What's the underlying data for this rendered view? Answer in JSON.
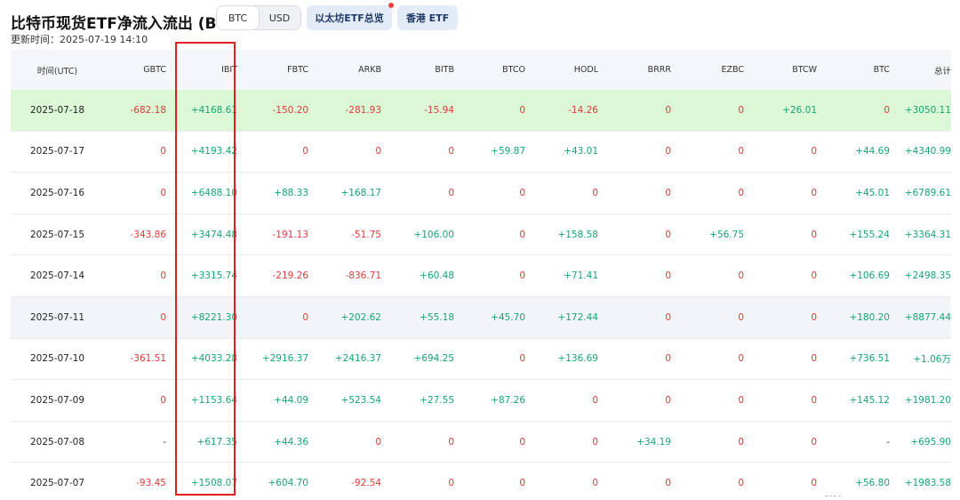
{
  "header": {
    "title": "比特币现货ETF净流入流出 (BTC)",
    "updated": "更新时间：2025-07-19 14:10",
    "unit_toggle": [
      "BTC",
      "USD"
    ],
    "unit_selected": "BTC",
    "eth_button": "以太坊ETF总览",
    "hk_button": "香港 ETF"
  },
  "columns": [
    "时间(UTC)",
    "GBTC",
    "IBIT",
    "FBTC",
    "ARKB",
    "BITB",
    "BTCO",
    "HODL",
    "BRRR",
    "EZBC",
    "BTCW",
    "BTC",
    "总计"
  ],
  "rows": [
    {
      "date": "2025-07-18",
      "values": [
        "-682.18",
        "+4168.61",
        "-150.20",
        "-281.93",
        "-15.94",
        "0",
        "-14.26",
        "0",
        "0",
        "+26.01",
        "0",
        "+3050.11"
      ]
    },
    {
      "date": "2025-07-17",
      "values": [
        "0",
        "+4193.42",
        "0",
        "0",
        "0",
        "+59.87",
        "+43.01",
        "0",
        "0",
        "0",
        "+44.69",
        "+4340.99"
      ]
    },
    {
      "date": "2025-07-16",
      "values": [
        "0",
        "+6488.10",
        "+88.33",
        "+168.17",
        "0",
        "0",
        "0",
        "0",
        "0",
        "0",
        "+45.01",
        "+6789.61"
      ]
    },
    {
      "date": "2025-07-15",
      "values": [
        "-343.86",
        "+3474.48",
        "-191.13",
        "-51.75",
        "+106.00",
        "0",
        "+158.58",
        "0",
        "+56.75",
        "0",
        "+155.24",
        "+3364.31"
      ]
    },
    {
      "date": "2025-07-14",
      "values": [
        "0",
        "+3315.74",
        "-219.26",
        "-836.71",
        "+60.48",
        "0",
        "+71.41",
        "0",
        "0",
        "0",
        "+106.69",
        "+2498.35"
      ]
    },
    {
      "date": "2025-07-11",
      "values": [
        "0",
        "+8221.30",
        "0",
        "+202.62",
        "+55.18",
        "+45.70",
        "+172.44",
        "0",
        "0",
        "0",
        "+180.20",
        "+8877.44"
      ]
    },
    {
      "date": "2025-07-10",
      "values": [
        "-361.51",
        "+4033.28",
        "+2916.37",
        "+2416.37",
        "+694.25",
        "0",
        "+136.69",
        "0",
        "0",
        "0",
        "+736.51",
        "+1.06万"
      ]
    },
    {
      "date": "2025-07-09",
      "values": [
        "0",
        "+1153.64",
        "+44.09",
        "+523.54",
        "+27.55",
        "+87.26",
        "0",
        "0",
        "0",
        "0",
        "+145.12",
        "+1981.20"
      ]
    },
    {
      "date": "2025-07-08",
      "values": [
        "-",
        "+617.35",
        "+44.36",
        "0",
        "0",
        "0",
        "0",
        "+34.19",
        "0",
        "0",
        "-",
        "+695.90"
      ]
    },
    {
      "date": "2025-07-07",
      "values": [
        "-93.45",
        "+1508.07",
        "+604.70",
        "-92.54",
        "0",
        "0",
        "0",
        "0",
        "0",
        "0",
        "+56.80",
        "+1983.58"
      ]
    }
  ],
  "colors": {
    "positive": "#16a574",
    "negative": "#e33a3a",
    "highlight_row": "#dcf7d6",
    "highlight_box": "#e11d1d"
  },
  "highlighted_column": "IBIT"
}
